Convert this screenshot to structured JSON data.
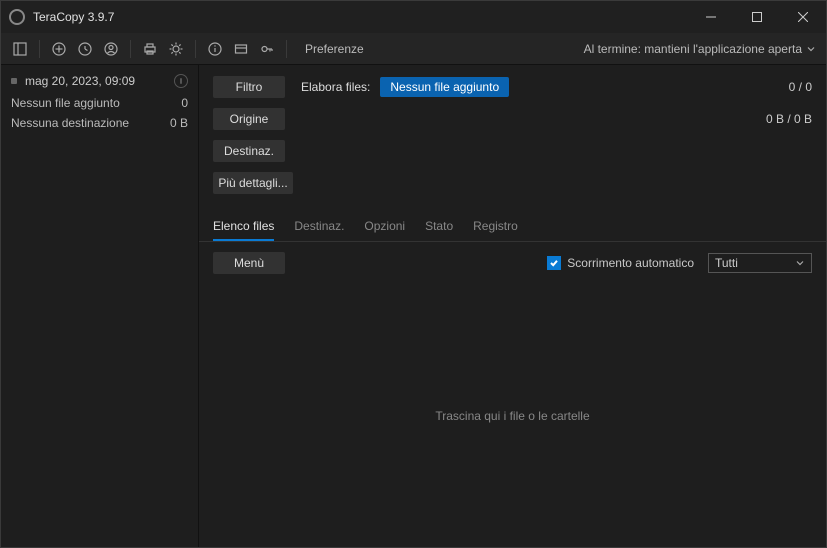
{
  "window": {
    "title": "TeraCopy 3.9.7"
  },
  "toolbar": {
    "prefs": "Preferenze",
    "on_finish": "Al termine: mantieni l'applicazione aperta"
  },
  "sidebar": {
    "history": {
      "ts": "mag 20, 2023, 09:09"
    },
    "line1": {
      "label": "Nessun file aggiunto",
      "value": "0"
    },
    "line2": {
      "label": "Nessuna destinazione",
      "value": "0 B"
    }
  },
  "main": {
    "filter_btn": "Filtro",
    "process_label": "Elabora files:",
    "file_badge": "Nessun file aggiunto",
    "count": "0 / 0",
    "source_btn": "Origine",
    "size": "0 B / 0 B",
    "dest_btn": "Destinaz.",
    "more_btn": "Più dettagli..."
  },
  "tabs": {
    "files": "Elenco files",
    "dest": "Destinaz.",
    "options": "Opzioni",
    "state": "Stato",
    "log": "Registro"
  },
  "options": {
    "menu_btn": "Menù",
    "autoscroll": "Scorrimento automatico",
    "filter_all": "Tutti"
  },
  "drop": {
    "hint": "Trascina qui i file o le cartelle"
  }
}
